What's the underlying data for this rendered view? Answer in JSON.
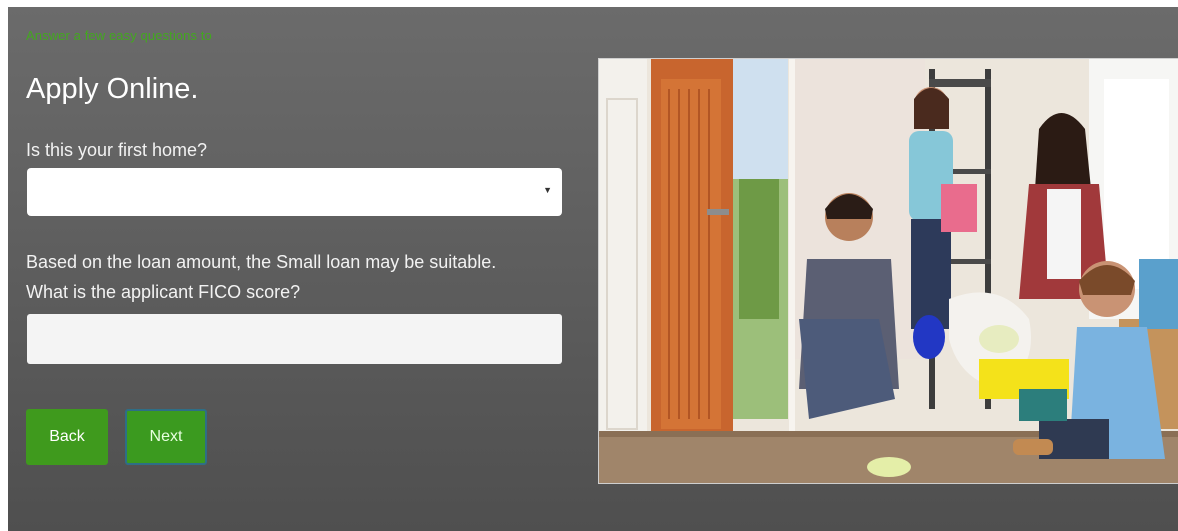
{
  "form": {
    "intro": "Answer a few easy questions to",
    "title": "Apply Online.",
    "question_first_home": "Is this your first home?",
    "first_home_value": "",
    "info_line": "Based on the loan amount, the Small loan may be suitable.",
    "question_fico": "What is the applicant FICO score?",
    "fico_value": "",
    "back_label": "Back",
    "next_label": "Next"
  },
  "colors": {
    "accent_green": "#3f9a1d",
    "intro_green": "#43a81f",
    "panel_gray": "#5f5f5f"
  },
  "photo": {
    "icon": "family-moving-home-photo"
  }
}
